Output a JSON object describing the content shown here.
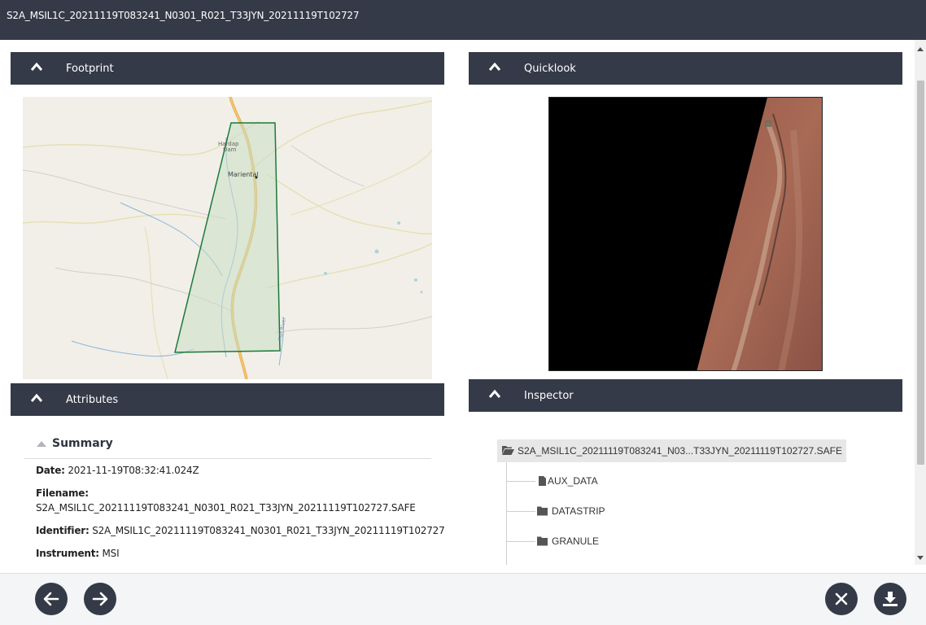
{
  "window": {
    "title": "S2A_MSIL1C_20211119T083241_N0301_R021_T33JYN_20211119T102727"
  },
  "panels": {
    "footprint": {
      "label": "Footprint"
    },
    "quicklook": {
      "label": "Quicklook"
    },
    "attributes": {
      "label": "Attributes"
    },
    "inspector": {
      "label": "Inspector"
    }
  },
  "map": {
    "places": [
      "Hardap Dam",
      "Mariental",
      "Fish River"
    ]
  },
  "summary": {
    "heading": "Summary",
    "date_label": "Date:",
    "date_value": "2021-11-19T08:32:41.024Z",
    "filename_label": "Filename:",
    "filename_value": "S2A_MSIL1C_20211119T083241_N0301_R021_T33JYN_20211119T102727.SAFE",
    "identifier_label": "Identifier:",
    "identifier_value": "S2A_MSIL1C_20211119T083241_N0301_R021_T33JYN_20211119T102727",
    "instrument_label": "Instrument:",
    "instrument_value": "MSI"
  },
  "inspector": {
    "root": "S2A_MSIL1C_20211119T083241_N03...T33JYN_20211119T102727.SAFE",
    "items": [
      {
        "label": "AUX_DATA",
        "icon": "file-icon"
      },
      {
        "label": "DATASTRIP",
        "icon": "folder-icon"
      },
      {
        "label": "GRANULE",
        "icon": "folder-icon"
      }
    ]
  },
  "footer": {
    "buttons": [
      "back-arrow-icon",
      "forward-arrow-icon",
      "close-icon",
      "download-icon"
    ]
  },
  "colors": {
    "header_bg": "#343a47",
    "footprint_stroke": "#1a7a3a",
    "footprint_fill": "#c9dfc4"
  }
}
